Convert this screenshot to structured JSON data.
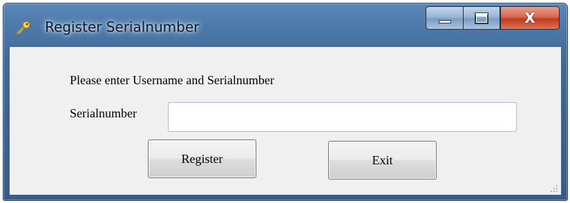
{
  "window": {
    "title": "Register Serialnumber",
    "title_icon": "key-icon",
    "caption_buttons": {
      "minimize_icon": "minimize-icon",
      "maximize_icon": "maximize-icon",
      "close_label": "X"
    }
  },
  "form": {
    "instruction": "Please enter Username and Serialnumber",
    "serial_label": "Serialnumber",
    "serial_value": "",
    "register_label": "Register",
    "exit_label": "Exit"
  },
  "colors": {
    "titlebar": "#3f6a98",
    "client_bg": "#f0f0f0",
    "close_button": "#c13a1f"
  }
}
